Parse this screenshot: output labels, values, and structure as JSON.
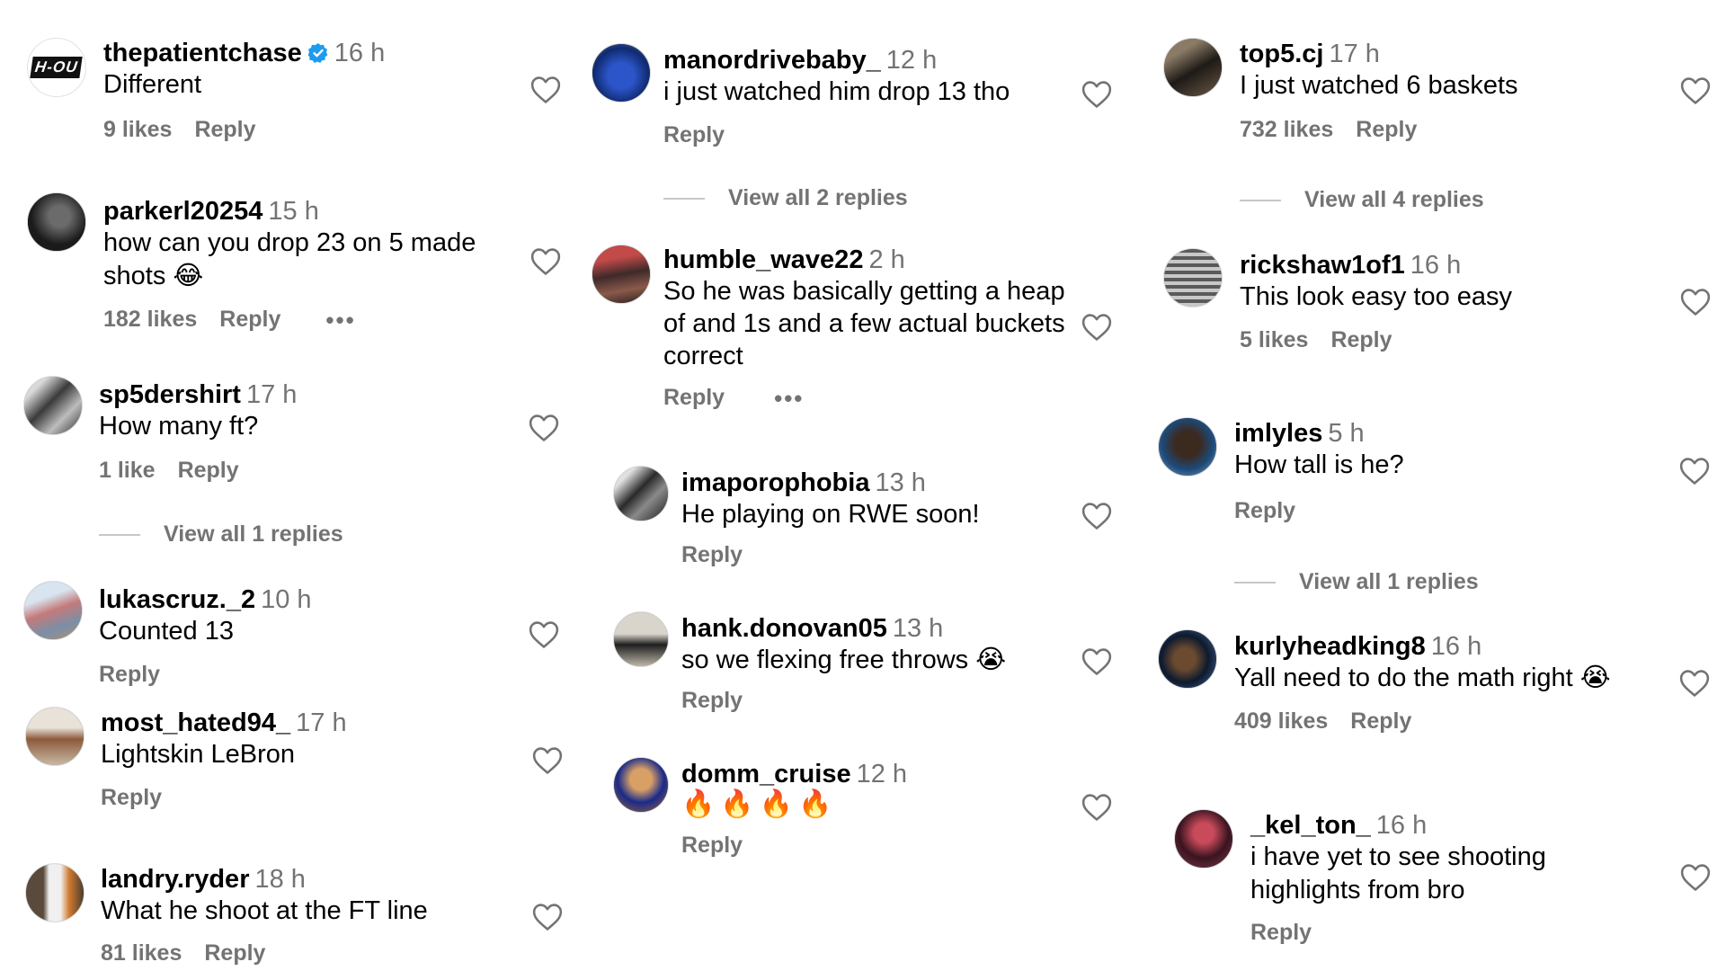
{
  "labels": {
    "reply": "Reply",
    "more": "•••"
  },
  "columns": [
    {
      "comments": [
        {
          "user": "thepatientchase",
          "verified": true,
          "time": "16 h",
          "text": "Different",
          "likes": "9 likes",
          "avatar_color": "#ffffff",
          "avatar_type": "logo",
          "logo_text": "H-OU"
        },
        {
          "user": "parkerl20254",
          "time": "15 h",
          "text": "how can you drop 23 on 5 made shots 😂",
          "likes": "182 likes",
          "more": true,
          "avatar_color": "#2a2a2a"
        },
        {
          "user": "sp5dershirt",
          "time": "17 h",
          "text": "How many ft?",
          "likes": "1 like",
          "avatar_color": "#5a5a5a",
          "view_all": "View all 1 replies"
        },
        {
          "user": "lukascruz._2",
          "time": "10 h",
          "text": "Counted 13",
          "likes": "",
          "avatar_color": "#b7a38f"
        },
        {
          "user": "most_hated94_",
          "time": "17 h",
          "text": "Lightskin LeBron",
          "likes": "",
          "avatar_color": "#a37d5c"
        },
        {
          "user": "landry.ryder",
          "time": "18 h",
          "text": "What he shoot at the FT line",
          "likes": "81 likes",
          "avatar_color": "#6d5d52"
        }
      ]
    },
    {
      "comments": [
        {
          "user": "manordrivebaby_",
          "time": "12 h",
          "text": "i just watched him drop 13 tho",
          "likes": "",
          "avatar_color": "#1d3c8f",
          "view_all": "View all 2 replies"
        },
        {
          "user": "humble_wave22",
          "time": "2 h",
          "text": "So he was basically getting a heap of and 1s and a few actual buckets correct",
          "likes": "",
          "more": true,
          "avatar_color": "#7a3a34"
        },
        {
          "user": "imaporophobia",
          "time": "13 h",
          "text": "He playing on RWE soon!",
          "likes": "",
          "avatar_color": "#3c3c3c"
        },
        {
          "user": "hank.donovan05",
          "time": "13 h",
          "text": "so we flexing free throws 😭",
          "likes": "",
          "avatar_color": "#7f7f7f"
        },
        {
          "user": "domm_cruise",
          "time": "12 h",
          "text": "🔥🔥🔥🔥",
          "likes": "",
          "avatar_color": "#a56a2e"
        }
      ]
    },
    {
      "comments": [
        {
          "user": "top5.cj",
          "time": "17 h",
          "text": "I just watched 6 baskets",
          "likes": "732 likes",
          "avatar_color": "#4a4036",
          "view_all": "View all 4 replies"
        },
        {
          "user": "rickshaw1of1",
          "time": "16 h",
          "text": "This look easy too easy",
          "likes": "5 likes",
          "avatar_color": "#9a9a9a"
        },
        {
          "user": "imlyles",
          "time": "5 h",
          "text": "How tall is he?",
          "likes": "",
          "avatar_color": "#2f4f6f",
          "view_all": "View all 1 replies"
        },
        {
          "user": "kurlyheadking8",
          "time": "16 h",
          "text": "Yall need to do the math right 😭",
          "likes": "409 likes",
          "avatar_color": "#1f3550"
        },
        {
          "user": "_kel_ton_",
          "time": "16 h",
          "text": "i have yet to see shooting highlights from bro",
          "likes": "",
          "avatar_color": "#5b2230"
        }
      ]
    }
  ]
}
